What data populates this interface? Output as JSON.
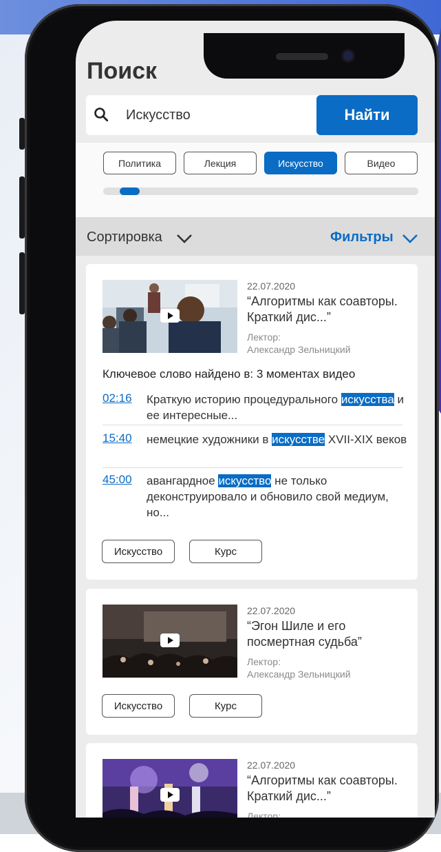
{
  "page": {
    "title": "Поиск"
  },
  "search": {
    "value": "Искусство",
    "button_label": "Найти"
  },
  "chips": [
    "Политика",
    "Лекция",
    "Искусство",
    "Видео"
  ],
  "sort": {
    "label": "Сортировка"
  },
  "filters": {
    "label": "Фильтры"
  },
  "colors": {
    "accent": "#0a6cc4",
    "screen_bg": "#ececec"
  },
  "results": [
    {
      "date": "22.07.2020",
      "title_line1": "“Алгоритмы как соавторы.",
      "title_line2": "Краткий дис...”",
      "lector_label": "Лектор:",
      "lector_name": "Александр Зельницкий",
      "keyword_summary": "Ключевое слово найдено в:  3 моментах видео",
      "moments": [
        {
          "time": "02:16",
          "before": "Краткую историю процедурального ",
          "hl": "искусства",
          "after": " и ее интересные..."
        },
        {
          "time": "15:40",
          "before": "немецкие художники в ",
          "hl": "искусстве",
          "after": " XVII-XIX веков"
        },
        {
          "time": "45:00",
          "before": "авангардное ",
          "hl": "искусство",
          "after": " не только деконструировало и обновило свой медиум, но..."
        }
      ],
      "tags": [
        "Искусство",
        "Курс"
      ]
    },
    {
      "date": "22.07.2020",
      "title_line1": "“Эгон Шиле и его",
      "title_line2": "посмертная судьба”",
      "lector_label": "Лектор:",
      "lector_name": "Александр Зельницкий",
      "tags": [
        "Искусство",
        "Курс"
      ]
    },
    {
      "date": "22.07.2020",
      "title_line1": "“Алгоритмы как соавторы.",
      "title_line2": "Краткий дис...”",
      "lector_label": "Лектор:"
    }
  ]
}
